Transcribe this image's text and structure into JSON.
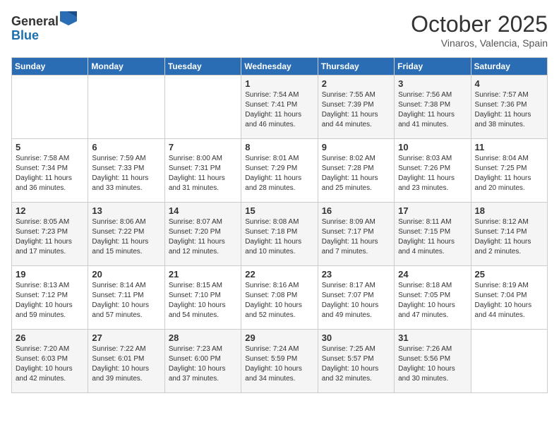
{
  "header": {
    "logo": {
      "general": "General",
      "blue": "Blue"
    },
    "title": "October 2025",
    "location": "Vinaros, Valencia, Spain"
  },
  "days_of_week": [
    "Sunday",
    "Monday",
    "Tuesday",
    "Wednesday",
    "Thursday",
    "Friday",
    "Saturday"
  ],
  "weeks": [
    [
      {
        "day": null,
        "info": null
      },
      {
        "day": null,
        "info": null
      },
      {
        "day": null,
        "info": null
      },
      {
        "day": "1",
        "info": "Sunrise: 7:54 AM\nSunset: 7:41 PM\nDaylight: 11 hours and 46 minutes."
      },
      {
        "day": "2",
        "info": "Sunrise: 7:55 AM\nSunset: 7:39 PM\nDaylight: 11 hours and 44 minutes."
      },
      {
        "day": "3",
        "info": "Sunrise: 7:56 AM\nSunset: 7:38 PM\nDaylight: 11 hours and 41 minutes."
      },
      {
        "day": "4",
        "info": "Sunrise: 7:57 AM\nSunset: 7:36 PM\nDaylight: 11 hours and 38 minutes."
      }
    ],
    [
      {
        "day": "5",
        "info": "Sunrise: 7:58 AM\nSunset: 7:34 PM\nDaylight: 11 hours and 36 minutes."
      },
      {
        "day": "6",
        "info": "Sunrise: 7:59 AM\nSunset: 7:33 PM\nDaylight: 11 hours and 33 minutes."
      },
      {
        "day": "7",
        "info": "Sunrise: 8:00 AM\nSunset: 7:31 PM\nDaylight: 11 hours and 31 minutes."
      },
      {
        "day": "8",
        "info": "Sunrise: 8:01 AM\nSunset: 7:29 PM\nDaylight: 11 hours and 28 minutes."
      },
      {
        "day": "9",
        "info": "Sunrise: 8:02 AM\nSunset: 7:28 PM\nDaylight: 11 hours and 25 minutes."
      },
      {
        "day": "10",
        "info": "Sunrise: 8:03 AM\nSunset: 7:26 PM\nDaylight: 11 hours and 23 minutes."
      },
      {
        "day": "11",
        "info": "Sunrise: 8:04 AM\nSunset: 7:25 PM\nDaylight: 11 hours and 20 minutes."
      }
    ],
    [
      {
        "day": "12",
        "info": "Sunrise: 8:05 AM\nSunset: 7:23 PM\nDaylight: 11 hours and 17 minutes."
      },
      {
        "day": "13",
        "info": "Sunrise: 8:06 AM\nSunset: 7:22 PM\nDaylight: 11 hours and 15 minutes."
      },
      {
        "day": "14",
        "info": "Sunrise: 8:07 AM\nSunset: 7:20 PM\nDaylight: 11 hours and 12 minutes."
      },
      {
        "day": "15",
        "info": "Sunrise: 8:08 AM\nSunset: 7:18 PM\nDaylight: 11 hours and 10 minutes."
      },
      {
        "day": "16",
        "info": "Sunrise: 8:09 AM\nSunset: 7:17 PM\nDaylight: 11 hours and 7 minutes."
      },
      {
        "day": "17",
        "info": "Sunrise: 8:11 AM\nSunset: 7:15 PM\nDaylight: 11 hours and 4 minutes."
      },
      {
        "day": "18",
        "info": "Sunrise: 8:12 AM\nSunset: 7:14 PM\nDaylight: 11 hours and 2 minutes."
      }
    ],
    [
      {
        "day": "19",
        "info": "Sunrise: 8:13 AM\nSunset: 7:12 PM\nDaylight: 10 hours and 59 minutes."
      },
      {
        "day": "20",
        "info": "Sunrise: 8:14 AM\nSunset: 7:11 PM\nDaylight: 10 hours and 57 minutes."
      },
      {
        "day": "21",
        "info": "Sunrise: 8:15 AM\nSunset: 7:10 PM\nDaylight: 10 hours and 54 minutes."
      },
      {
        "day": "22",
        "info": "Sunrise: 8:16 AM\nSunset: 7:08 PM\nDaylight: 10 hours and 52 minutes."
      },
      {
        "day": "23",
        "info": "Sunrise: 8:17 AM\nSunset: 7:07 PM\nDaylight: 10 hours and 49 minutes."
      },
      {
        "day": "24",
        "info": "Sunrise: 8:18 AM\nSunset: 7:05 PM\nDaylight: 10 hours and 47 minutes."
      },
      {
        "day": "25",
        "info": "Sunrise: 8:19 AM\nSunset: 7:04 PM\nDaylight: 10 hours and 44 minutes."
      }
    ],
    [
      {
        "day": "26",
        "info": "Sunrise: 7:20 AM\nSunset: 6:03 PM\nDaylight: 10 hours and 42 minutes."
      },
      {
        "day": "27",
        "info": "Sunrise: 7:22 AM\nSunset: 6:01 PM\nDaylight: 10 hours and 39 minutes."
      },
      {
        "day": "28",
        "info": "Sunrise: 7:23 AM\nSunset: 6:00 PM\nDaylight: 10 hours and 37 minutes."
      },
      {
        "day": "29",
        "info": "Sunrise: 7:24 AM\nSunset: 5:59 PM\nDaylight: 10 hours and 34 minutes."
      },
      {
        "day": "30",
        "info": "Sunrise: 7:25 AM\nSunset: 5:57 PM\nDaylight: 10 hours and 32 minutes."
      },
      {
        "day": "31",
        "info": "Sunrise: 7:26 AM\nSunset: 5:56 PM\nDaylight: 10 hours and 30 minutes."
      },
      {
        "day": null,
        "info": null
      }
    ]
  ]
}
